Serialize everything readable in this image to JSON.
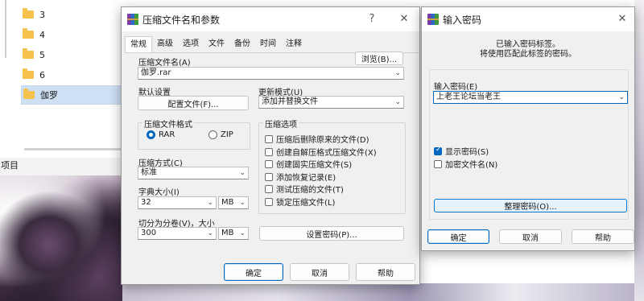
{
  "explorer": {
    "folders": [
      "3",
      "4",
      "5",
      "6",
      "伽罗"
    ],
    "selected_folder": "伽罗",
    "left_label": "项目"
  },
  "archive_dialog": {
    "title": "压缩文件名和参数",
    "help_glyph": "?",
    "close_glyph": "✕",
    "tabs": [
      "常规",
      "高级",
      "选项",
      "文件",
      "备份",
      "时间",
      "注释"
    ],
    "active_tab": "常规",
    "archive_name_label": "压缩文件名(A)",
    "browse_button": "浏览(B)...",
    "archive_name_value": "伽罗.rar",
    "default_settings_label": "默认设置",
    "profiles_button": "配置文件(F)...",
    "update_mode_label": "更新模式(U)",
    "update_mode_value": "添加并替换文件",
    "format_group": "压缩文件格式",
    "format_rar": "RAR",
    "format_zip": "ZIP",
    "method_label": "压缩方式(C)",
    "method_value": "标准",
    "dict_label": "字典大小(I)",
    "dict_value": "32",
    "dict_unit": "MB",
    "split_label": "切分为分卷(V)，大小",
    "split_value": "300",
    "split_unit": "MB",
    "options_group": "压缩选项",
    "options": [
      "压缩后删除原来的文件(D)",
      "创建自解压格式压缩文件(X)",
      "创建固实压缩文件(S)",
      "添加恢复记录(E)",
      "测试压缩的文件(T)",
      "锁定压缩文件(L)"
    ],
    "set_password_button": "设置密码(P)...",
    "ok_button": "确定",
    "cancel_button": "取消",
    "help_button": "帮助"
  },
  "password_dialog": {
    "title": "输入密码",
    "close_glyph": "✕",
    "info_line1": "已输入密码标签。",
    "info_line2": "将使用匹配此标签的密码。",
    "enter_password_label": "输入密码(E)",
    "password_value": "上老王论坛当老王",
    "show_password_label": "显示密码(S)",
    "show_password_checked": true,
    "encrypt_names_label": "加密文件名(N)",
    "encrypt_names_checked": false,
    "organize_button": "整理密码(O)...",
    "ok_button": "确定",
    "cancel_button": "取消",
    "help_button": "帮助"
  },
  "icons": [
    "folder-icon",
    "winrar-icon",
    "help-icon",
    "close-icon",
    "chevron-down-icon",
    "checkbox-icon",
    "radio-icon"
  ],
  "colors": {
    "accent": "#0067c0",
    "dialog_bg": "#f0f0f0",
    "folder": "#f5c24b"
  }
}
